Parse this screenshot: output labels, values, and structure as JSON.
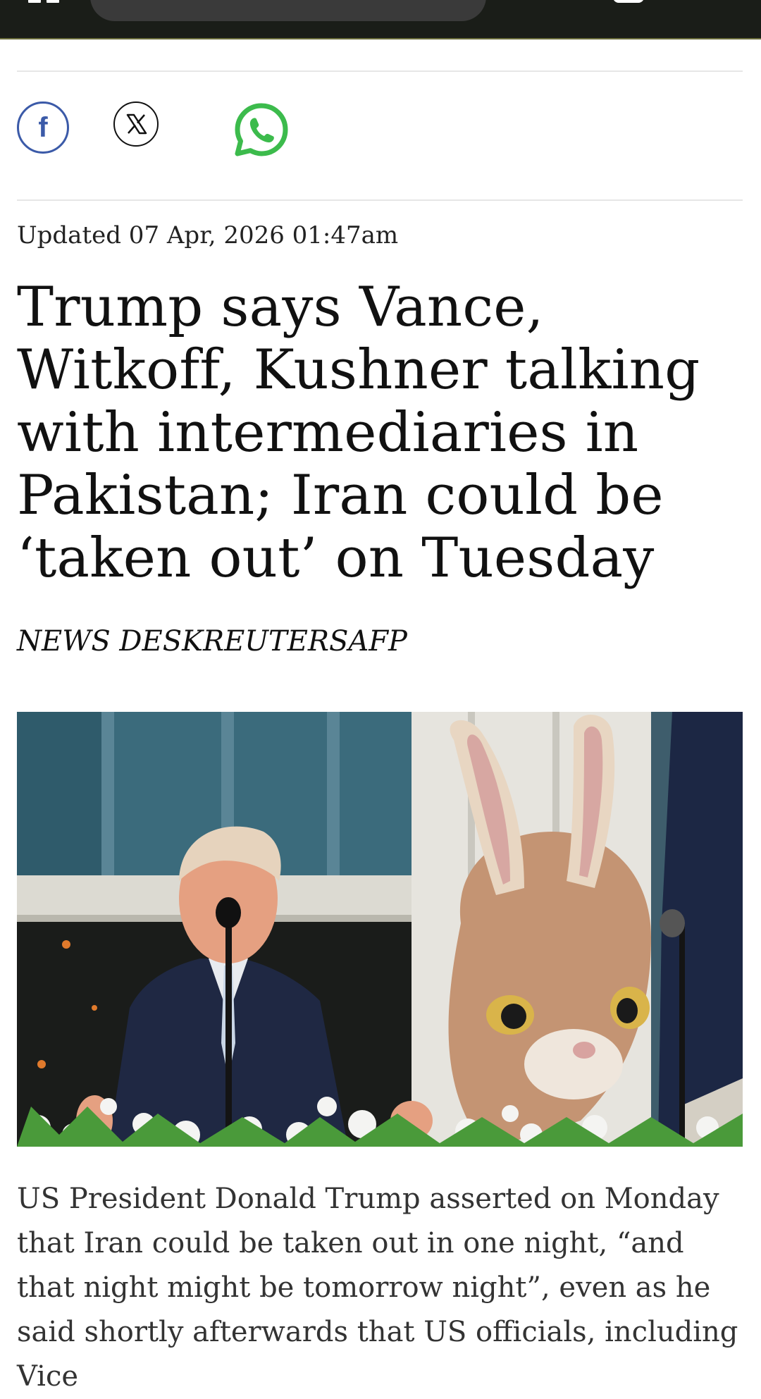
{
  "topbar": {
    "menu_icon": "menu-icon",
    "search_icon": "search-pill"
  },
  "share": {
    "facebook_icon": "facebook-icon",
    "x_icon": "x-icon",
    "whatsapp_icon": "whatsapp-icon",
    "colors": {
      "facebook": "#3b5aa8",
      "whatsapp": "#3cbb4c",
      "x": "#111111"
    }
  },
  "article": {
    "updated": "Updated 07 Apr, 2026 01:47am",
    "headline": "Trump says Vance, Witkoff, Kushner talking with intermediaries in Pakistan; Iran could be ‘taken out’ on Tuesday",
    "byline": "NEWS DESKREUTERSAFP",
    "body": "US President Donald Trump asserted on Monday that Iran could be taken out in one night, “and that night might be tomorrow night”, even as he said shortly afterwards that US officials, including Vice"
  }
}
